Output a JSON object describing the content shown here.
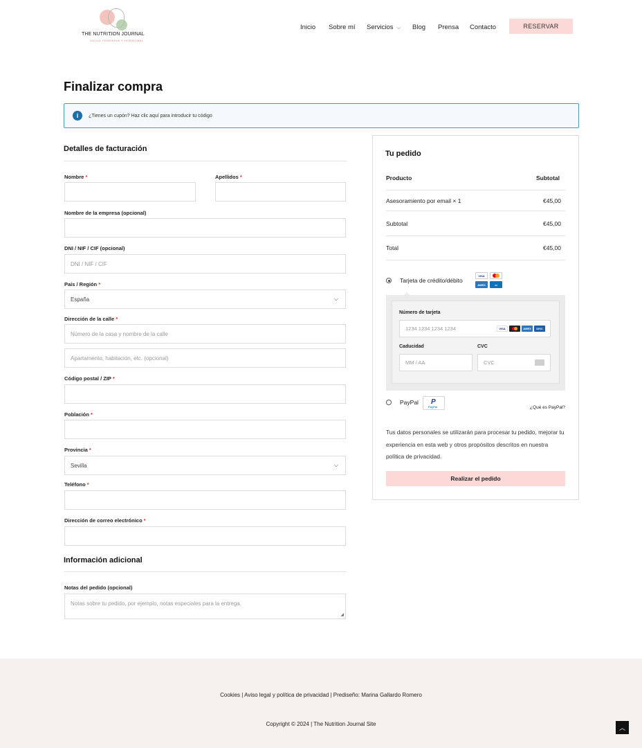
{
  "header": {
    "logo_title": "THE NUTRITION JOURNAL",
    "logo_subtitle": "SALUD FEMENINA Y HORMONAL",
    "nav": [
      "Inicio",
      "Sobre mí",
      "Servicios",
      "Blog",
      "Prensa",
      "Contacto"
    ],
    "cta": "RESERVAR"
  },
  "page": {
    "title": "Finalizar compra",
    "coupon_text": "¿Tienes un cupón? Haz clic aquí para introducir tu código"
  },
  "billing": {
    "heading": "Detalles de facturación",
    "first_name_label": "Nombre",
    "last_name_label": "Apellidos",
    "company_label": "Nombre de la empresa (opcional)",
    "nif_label": "DNI / NIF / CIF (opcional)",
    "nif_placeholder": "DNI / NIF / CIF",
    "country_label": "País / Región",
    "country_value": "España",
    "street_label": "Dirección de la calle",
    "street_placeholder": "Número de la casa y nombre de la calle",
    "street2_placeholder": "Apartamento, habitación, etc. (opcional)",
    "postcode_label": "Código postal / ZIP",
    "city_label": "Población",
    "province_label": "Provincia",
    "province_value": "Sevilla",
    "phone_label": "Teléfono",
    "email_label": "Dirección de correo electrónico",
    "required_mark": "*"
  },
  "additional": {
    "heading": "Información adicional",
    "notes_label": "Notas del pedido (opcional)",
    "notes_placeholder": "Notas sobre tu pedido, por ejemplo, notas especiales para la entrega."
  },
  "order": {
    "heading": "Tu pedido",
    "col_product": "Producto",
    "col_subtotal": "Subtotal",
    "item_name": "Asesoramiento por email",
    "item_qty": "× 1",
    "item_price": "€45,00",
    "subtotal_label": "Subtotal",
    "subtotal_value": "€45,00",
    "total_label": "Total",
    "total_value": "€45,00",
    "pay_card_label": "Tarjeta de crédito/débito",
    "card_number_label": "Número de tarjeta",
    "card_number_placeholder": "1234 1234 1234 1234",
    "expiry_label": "Caducidad",
    "expiry_placeholder": "MM / AA",
    "cvc_label": "CVC",
    "cvc_placeholder": "CVC",
    "pay_paypal_label": "PayPal",
    "paypal_logo_p": "P",
    "paypal_logo_text": "PayPal",
    "paypal_link": "¿Qué es PayPal?",
    "brand_visa": "VISA",
    "brand_amex": "AMEX",
    "brand_discover": "DISC",
    "privacy_text": "Tus datos personales se utilizarán para procesar tu pedido, mejorar tu experiencia en esta web y otros propósitos descritos en nuestra política de privacidad.",
    "place_order": "Realizar el pedido"
  },
  "footer": {
    "links": "Cookies | Aviso legal y política de privacidad | Prediseño: Marina Gallardo Romero",
    "copyright": "Copyright © 2024 | The Nutrition Journal Site"
  },
  "colors": {
    "accent_pink": "#fbd9d6",
    "info_blue": "#1e6fa8",
    "required_red": "#d2332a",
    "footer_bg": "#f4f1ee"
  }
}
